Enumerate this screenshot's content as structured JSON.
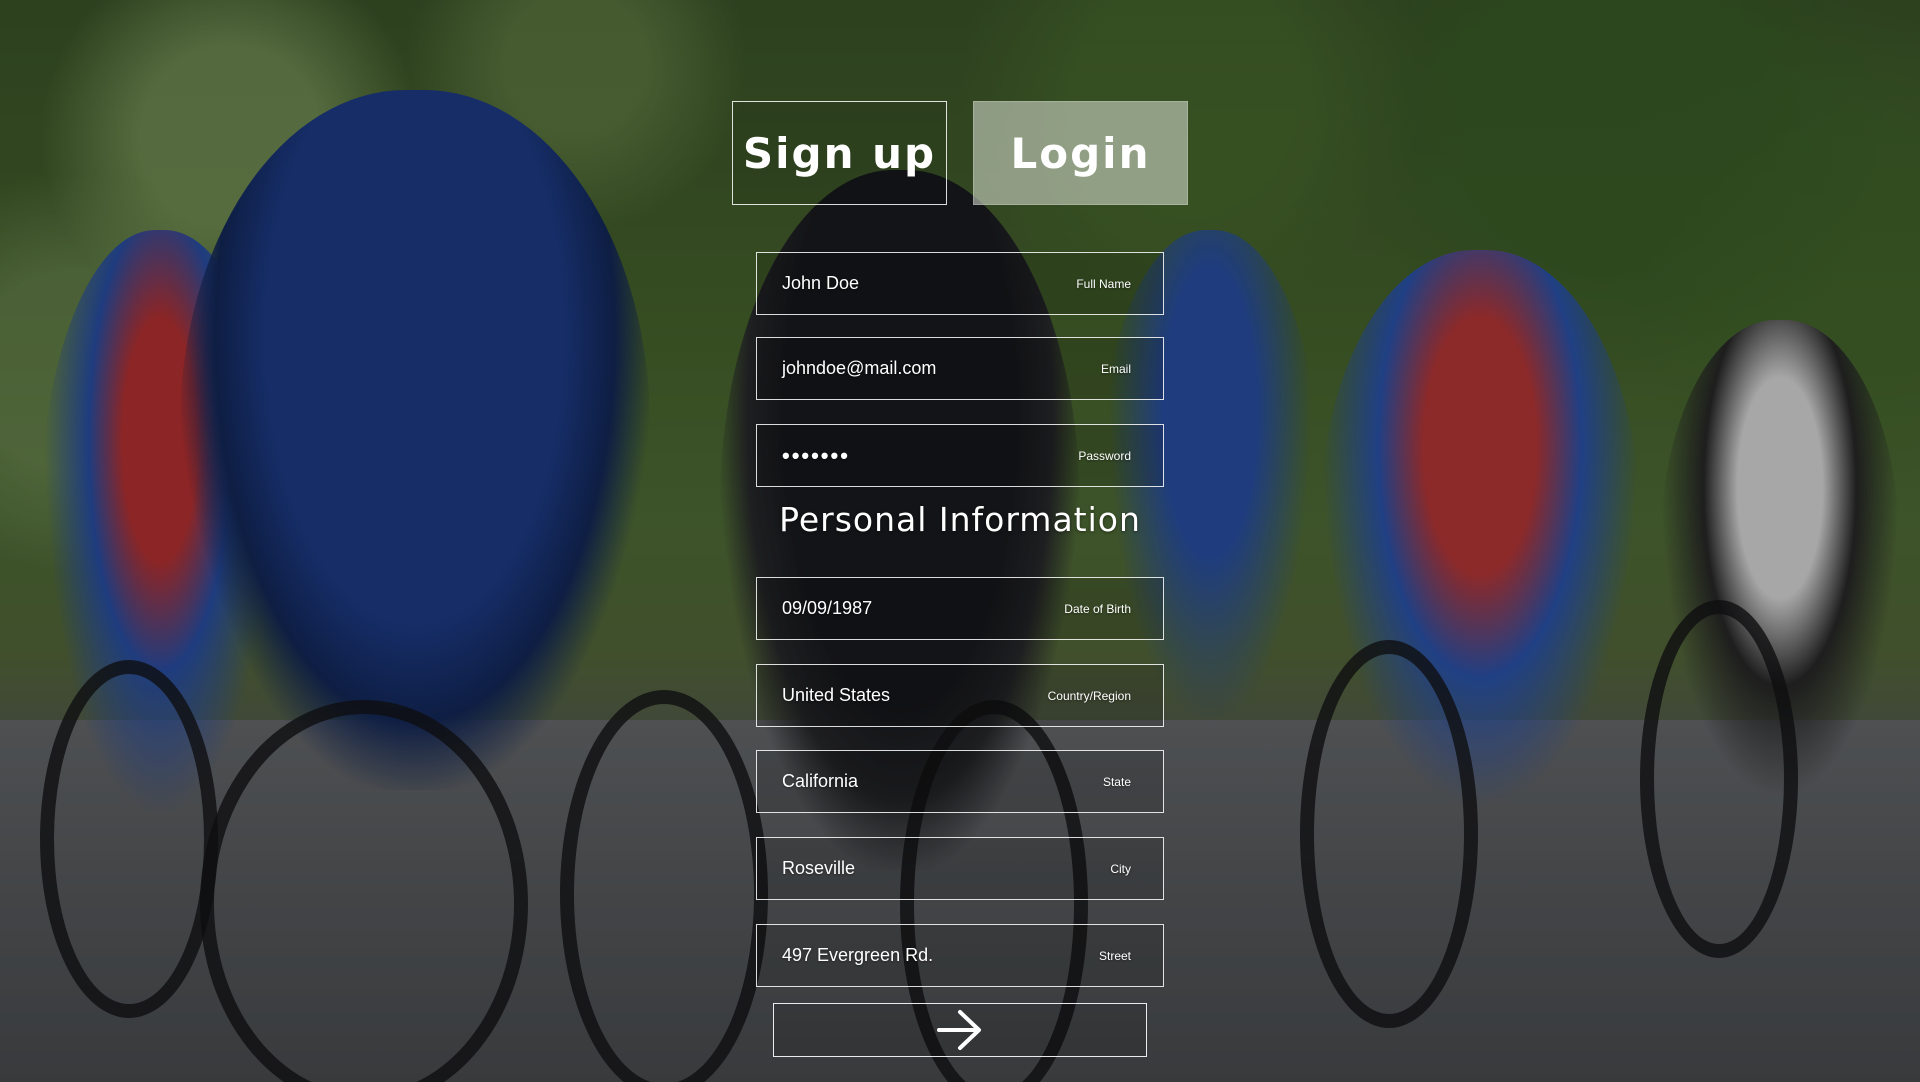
{
  "tabs": {
    "signup": "Sign up",
    "login": "Login"
  },
  "account": {
    "full_name": {
      "value": "John Doe",
      "label": "Full Name"
    },
    "email": {
      "value": "johndoe@mail.com",
      "label": "Email"
    },
    "password": {
      "value": "•••••••",
      "label": "Password"
    }
  },
  "personal": {
    "title": "Personal Information",
    "dob": {
      "value": "09/09/1987",
      "label": "Date of Birth"
    },
    "country": {
      "value": "United States",
      "label": "Country/Region"
    },
    "state": {
      "value": "California",
      "label": "State"
    },
    "city": {
      "value": "Roseville",
      "label": "City"
    },
    "street": {
      "value": "497 Evergreen Rd.",
      "label": "Street"
    }
  },
  "submit": {
    "icon": "arrow-right-icon"
  },
  "background": {
    "image": "cycling-peloton-photo"
  }
}
